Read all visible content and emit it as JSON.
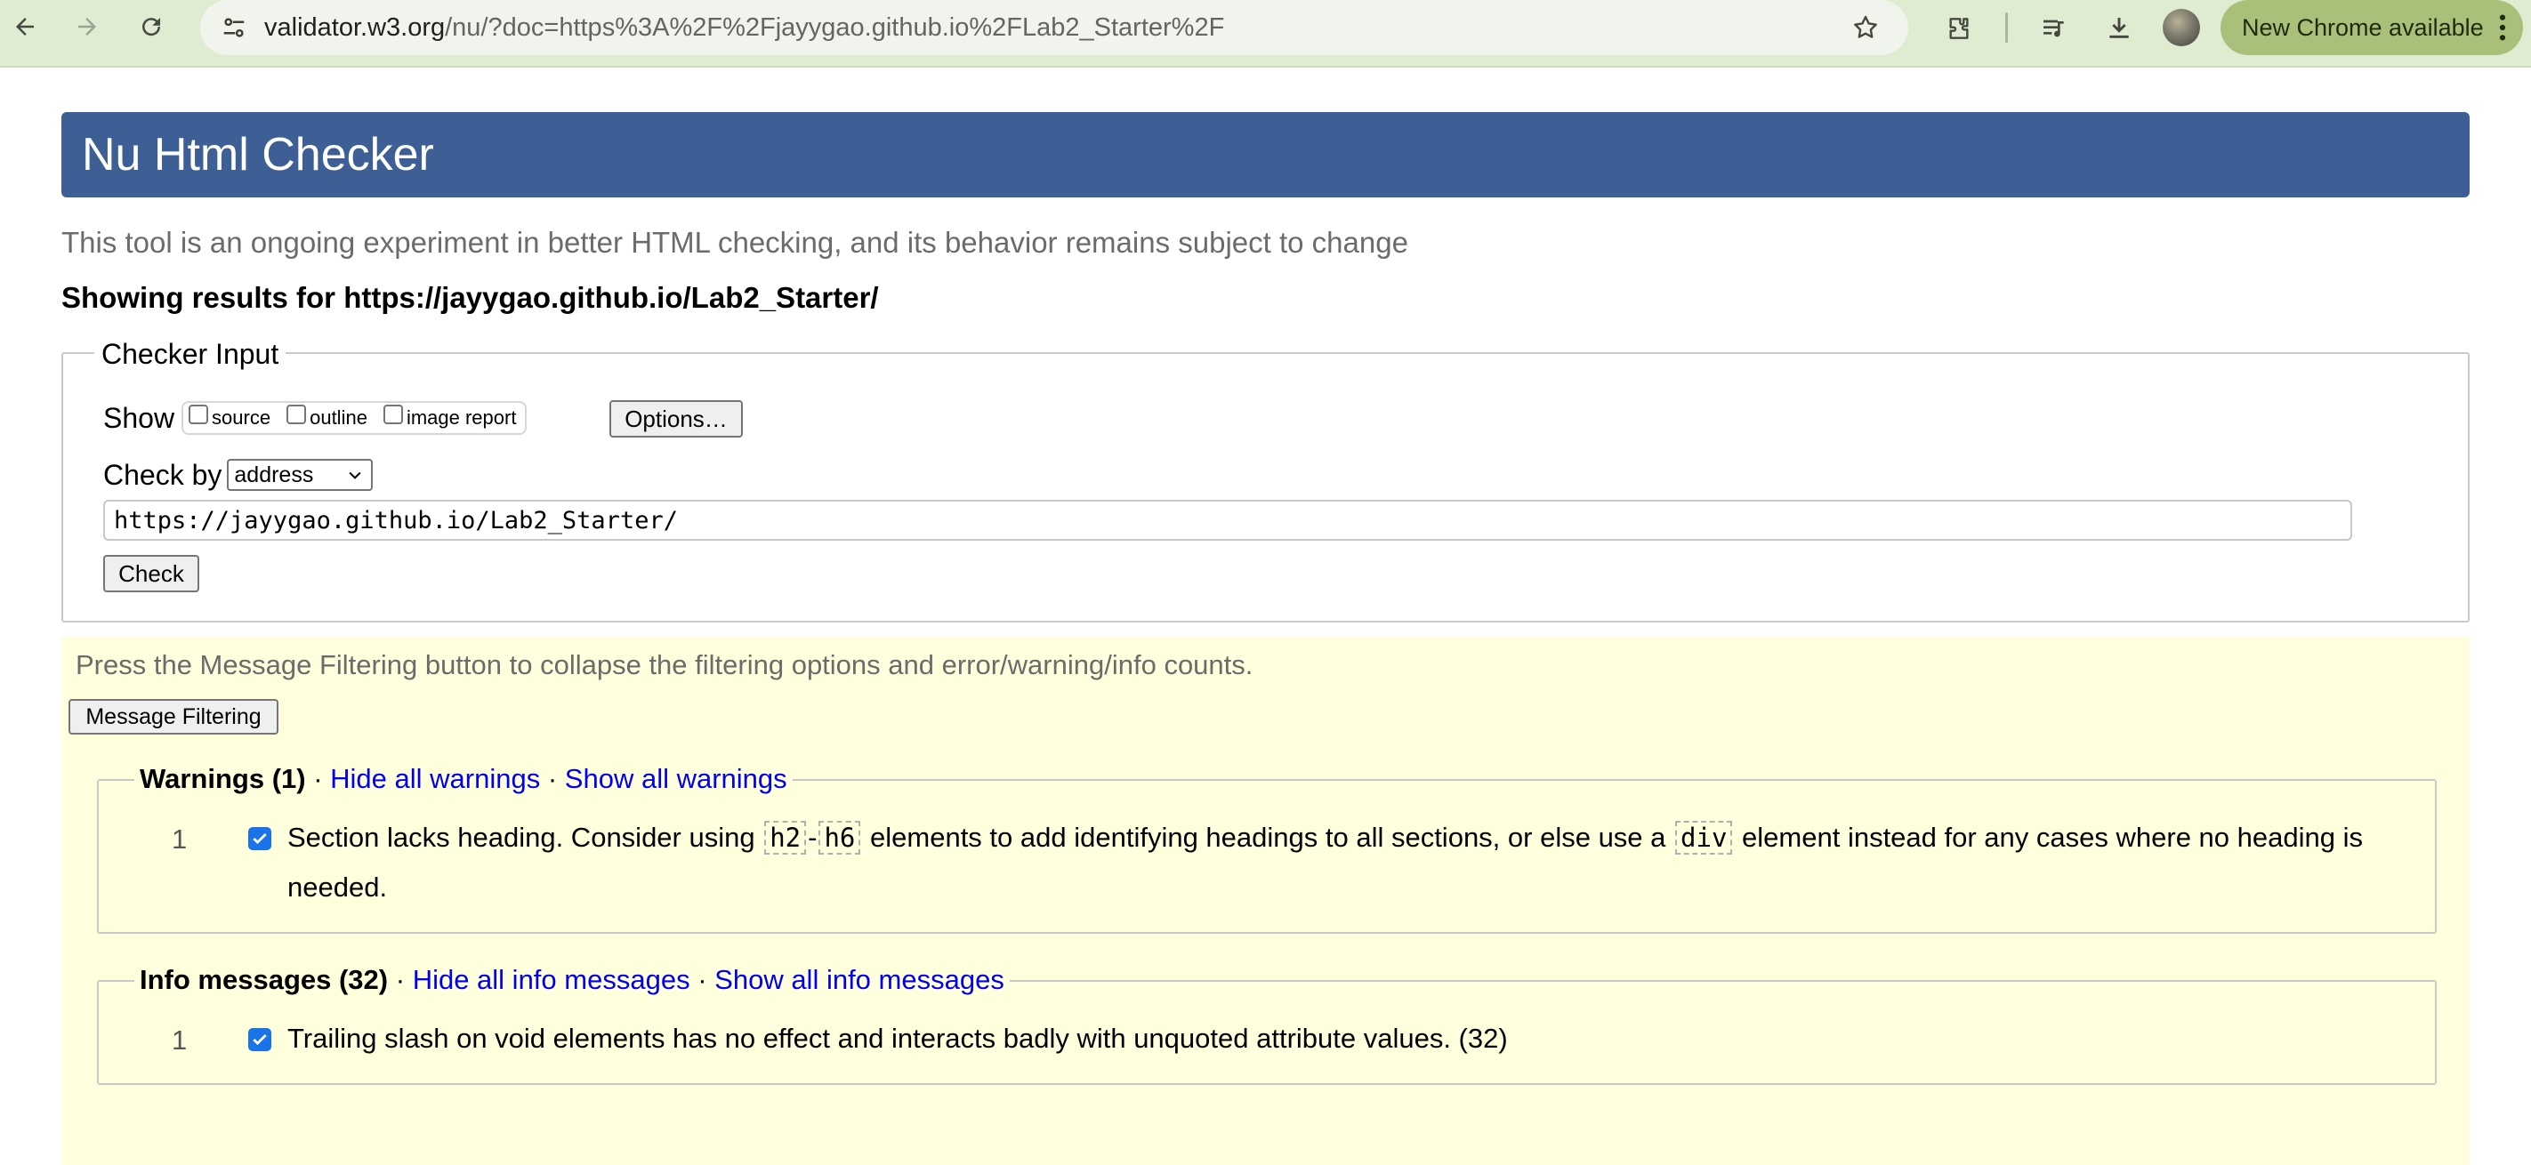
{
  "browser": {
    "url_host": "validator.w3.org",
    "url_rest": "/nu/?doc=https%3A%2F%2Fjayygao.github.io%2FLab2_Starter%2F",
    "update_label": "New Chrome available"
  },
  "header": {
    "title": "Nu Html Checker"
  },
  "subtitle": "This tool is an ongoing experiment in better HTML checking, and its behavior remains subject to change",
  "results_for": "Showing results for https://jayygao.github.io/Lab2_Starter/",
  "checker": {
    "legend": "Checker Input",
    "show_label": "Show",
    "show_options": [
      "source",
      "outline",
      "image report"
    ],
    "options_button": "Options…",
    "check_by_label": "Check by",
    "check_by_value": "address",
    "url_value": "https://jayygao.github.io/Lab2_Starter/",
    "check_button": "Check"
  },
  "messages": {
    "hint": "Press the Message Filtering button to collapse the filtering options and error/warning/info counts.",
    "filter_button": "Message Filtering",
    "warnings": {
      "title": "Warnings (1)",
      "hide": "Hide all warnings",
      "show": "Show all warnings",
      "items": [
        {
          "num": "1",
          "text_a": "Section lacks heading. Consider using",
          "code_a": "h2",
          "sep": "-",
          "code_b": "h6",
          "text_b": "elements to add identifying headings to all sections, or else use a",
          "code_c": "div",
          "text_c": "element instead for any cases where no heading is needed."
        }
      ]
    },
    "info": {
      "title": "Info messages (32)",
      "hide": "Hide all info messages",
      "show": "Show all info messages",
      "items": [
        {
          "num": "1",
          "text": "Trailing slash on void elements has no effect and interacts badly with unquoted attribute values. (32)"
        }
      ]
    }
  },
  "colors": {
    "header_bar": "#3e5f96",
    "message_bg": "#ffffdd",
    "link": "#0000ee",
    "checkbox_checked": "#1a73e8"
  }
}
